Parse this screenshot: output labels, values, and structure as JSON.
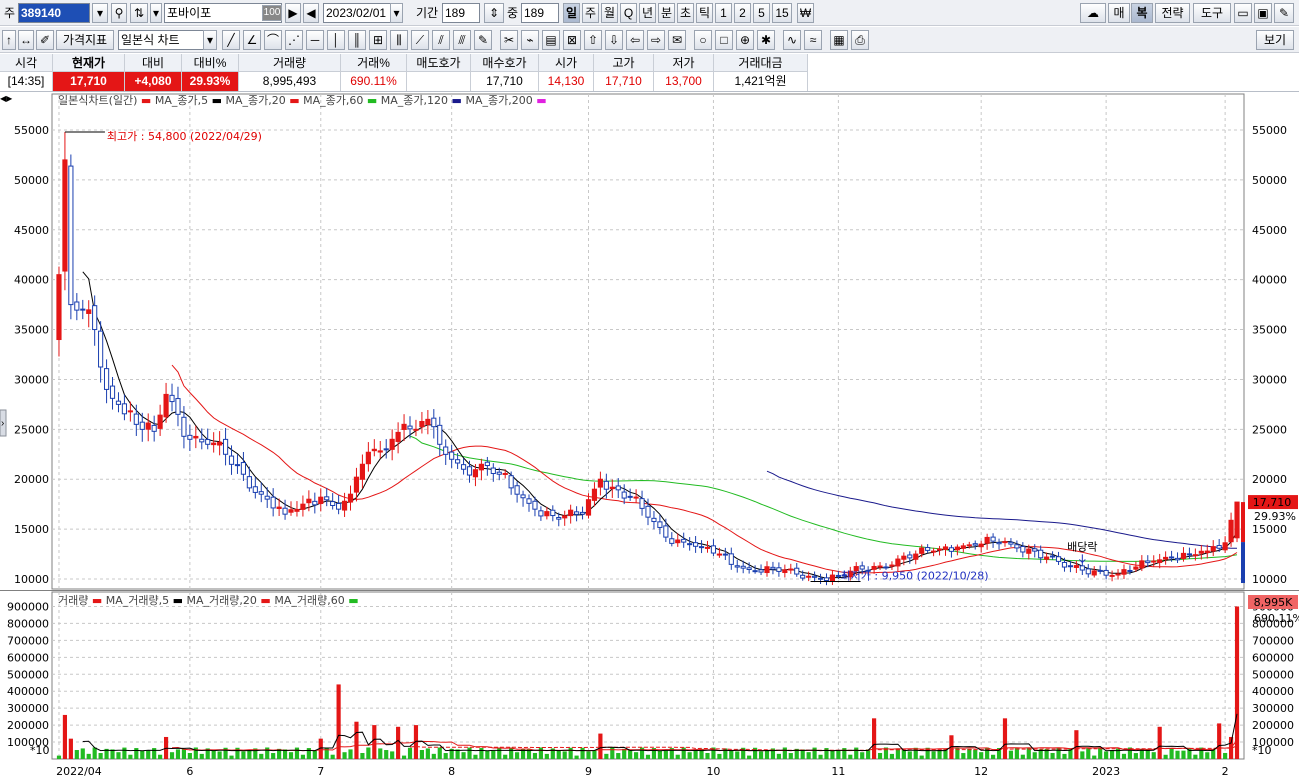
{
  "toolbar": {
    "code_prefix": "주",
    "stock_code": "389140",
    "stock_name": "포바이포",
    "name_badge": "100",
    "date": "2023/02/01",
    "period_label": "기간",
    "period_value": "189",
    "count_label": "중",
    "count_value": "189",
    "periods": [
      "일",
      "주",
      "월",
      "Q",
      "년",
      "분",
      "초",
      "틱",
      "1",
      "2",
      "5",
      "15"
    ],
    "active_period": "일",
    "right_buttons": [
      "매",
      "복",
      "전략",
      "도구"
    ],
    "indicator_button": "가격지표",
    "chart_type": "일본식 차트",
    "view_button": "보기"
  },
  "quote": {
    "headers": [
      "시각",
      "현재가",
      "대비",
      "대비%",
      "거래량",
      "거래%",
      "매도호가",
      "매수호가",
      "시가",
      "고가",
      "저가",
      "거래대금"
    ],
    "values": [
      "[14:35]",
      "17,710",
      "+4,080",
      "29.93%",
      "8,995,493",
      "690.11%",
      "",
      "17,710",
      "14,130",
      "17,710",
      "13,700",
      "1,421억원"
    ]
  },
  "price_panel": {
    "legend_title": "일본식차트(일간)",
    "legend_items": [
      "MA_종가,5",
      "MA_종가,20",
      "MA_종가,60",
      "MA_종가,120",
      "MA_종가,200"
    ],
    "high_annotation": "최고가 : 54,800 (2022/04/29)",
    "low_annotation": "최저가 : 9,950 (2022/10/28)",
    "dividend_label": "배당락",
    "current_price_tag": "17,710",
    "current_pct_tag": "29.93%"
  },
  "volume_panel": {
    "legend_title": "거래량",
    "legend_items": [
      "MA_거래량,5",
      "MA_거래량,20",
      "MA_거래량,60"
    ],
    "multiplier": "*10",
    "current_vol_tag": "8,995K",
    "current_pct_tag": "690.11%"
  },
  "colors": {
    "up": "#e41616",
    "down": "#1a3fb0",
    "ma5": "#000000",
    "ma20": "#e41616",
    "ma60": "#22bb22",
    "ma120": "#1a1a8c",
    "ma200": "#e020e0",
    "grid": "#c8c8c8"
  },
  "chart_data": [
    {
      "type": "candlestick",
      "title": "일본식차트(일간)",
      "ylim": [
        9000,
        57000
      ],
      "yticks": [
        10000,
        15000,
        20000,
        25000,
        30000,
        35000,
        40000,
        45000,
        50000,
        55000
      ],
      "x_labels": [
        "2022/04",
        "6",
        "7",
        "8",
        "9",
        "10",
        "11",
        "12",
        "2023",
        "2"
      ],
      "x_label_index": [
        0,
        22,
        44,
        66,
        89,
        110,
        131,
        155,
        176,
        196
      ],
      "n_bars": 199,
      "anchors_close": [
        [
          0,
          40500
        ],
        [
          1,
          52000
        ],
        [
          2,
          37500
        ],
        [
          4,
          37000
        ],
        [
          6,
          35000
        ],
        [
          8,
          29000
        ],
        [
          10,
          27500
        ],
        [
          13,
          25500
        ],
        [
          16,
          24800
        ],
        [
          18,
          28500
        ],
        [
          20,
          26500
        ],
        [
          22,
          24000
        ],
        [
          25,
          23500
        ],
        [
          28,
          22500
        ],
        [
          31,
          20500
        ],
        [
          34,
          18500
        ],
        [
          38,
          16500
        ],
        [
          41,
          17500
        ],
        [
          44,
          18200
        ],
        [
          47,
          17000
        ],
        [
          49,
          18500
        ],
        [
          51,
          21500
        ],
        [
          53,
          23000
        ],
        [
          56,
          24000
        ],
        [
          58,
          25500
        ],
        [
          60,
          25000
        ],
        [
          62,
          26000
        ],
        [
          64,
          23500
        ],
        [
          66,
          22000
        ],
        [
          68,
          21000
        ],
        [
          71,
          21500
        ],
        [
          74,
          20500
        ],
        [
          77,
          18500
        ],
        [
          80,
          17000
        ],
        [
          84,
          16000
        ],
        [
          88,
          16500
        ],
        [
          90,
          19000
        ],
        [
          91,
          20000
        ],
        [
          93,
          19200
        ],
        [
          96,
          18200
        ],
        [
          99,
          16200
        ],
        [
          102,
          14200
        ],
        [
          106,
          13500
        ],
        [
          108,
          13200
        ],
        [
          111,
          12500
        ],
        [
          114,
          11200
        ],
        [
          117,
          10800
        ],
        [
          120,
          11000
        ],
        [
          124,
          10500
        ],
        [
          128,
          10000
        ],
        [
          131,
          10300
        ],
        [
          135,
          11000
        ],
        [
          138,
          11300
        ],
        [
          141,
          12000
        ],
        [
          144,
          12500
        ],
        [
          147,
          12800
        ],
        [
          151,
          13200
        ],
        [
          154,
          13400
        ],
        [
          157,
          13800
        ],
        [
          160,
          13500
        ],
        [
          163,
          13000
        ],
        [
          166,
          12200
        ],
        [
          169,
          11200
        ],
        [
          172,
          10900
        ],
        [
          175,
          10800
        ],
        [
          178,
          10500
        ],
        [
          181,
          11200
        ],
        [
          184,
          11800
        ],
        [
          187,
          12200
        ],
        [
          190,
          12500
        ],
        [
          193,
          12800
        ],
        [
          196,
          13630
        ],
        [
          198,
          17710
        ]
      ],
      "first_open": 34000,
      "last": {
        "open": 14130,
        "high": 17710,
        "low": 13700,
        "close": 17710
      },
      "high": {
        "value": 54800,
        "date": "2022/04/29"
      },
      "low": {
        "value": 9950,
        "date": "2022/10/28"
      }
    },
    {
      "type": "bar",
      "title": "거래량",
      "multiplier": 10,
      "ylim": [
        0,
        950000
      ],
      "yticks": [
        100000,
        200000,
        300000,
        400000,
        500000,
        600000,
        700000,
        800000,
        900000
      ],
      "spikes": [
        [
          1,
          260000
        ],
        [
          2,
          120000
        ],
        [
          18,
          130000
        ],
        [
          44,
          120000
        ],
        [
          47,
          440000
        ],
        [
          50,
          220000
        ],
        [
          53,
          200000
        ],
        [
          57,
          190000
        ],
        [
          60,
          200000
        ],
        [
          91,
          150000
        ],
        [
          137,
          240000
        ],
        [
          150,
          140000
        ],
        [
          159,
          240000
        ],
        [
          171,
          170000
        ],
        [
          185,
          190000
        ],
        [
          195,
          210000
        ],
        [
          197,
          130000
        ],
        [
          198,
          900000
        ]
      ],
      "base_volume": 40000,
      "last_volume_k": 8995
    }
  ]
}
